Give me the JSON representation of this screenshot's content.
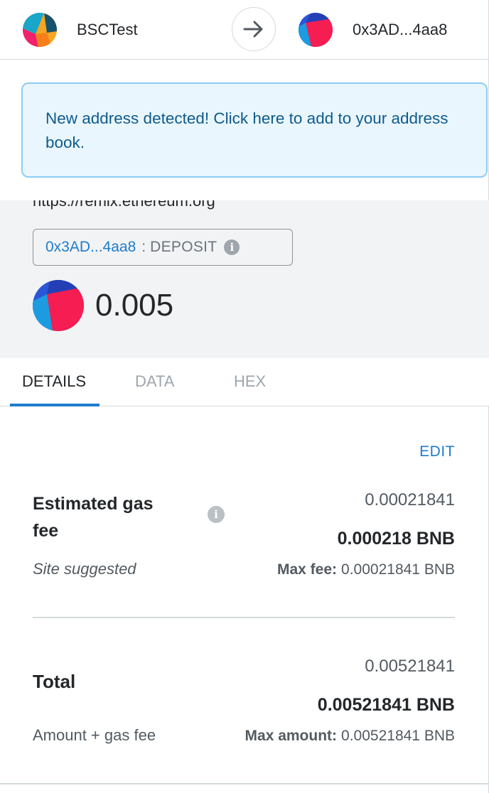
{
  "header": {
    "from_account": "BSCTest",
    "to_account": "0x3AD...4aa8"
  },
  "banner": {
    "text": "New address detected! Click here to add to your address book."
  },
  "summary": {
    "origin": "https://remix.ethereum.org",
    "method_address": "0x3AD...4aa8",
    "method_separator": ":",
    "method_name": "DEPOSIT",
    "amount": "0.005"
  },
  "tabs": [
    {
      "label": "DETAILS",
      "active": true
    },
    {
      "label": "DATA",
      "active": false
    },
    {
      "label": "HEX",
      "active": false
    }
  ],
  "details": {
    "edit_label": "EDIT",
    "gas": {
      "label": "Estimated gas fee",
      "sublabel": "Site suggested",
      "value": "0.00021841",
      "value_bold": "0.000218 BNB",
      "max_label": "Max fee:",
      "max_value": "0.00021841 BNB"
    },
    "total": {
      "label": "Total",
      "sublabel": "Amount + gas fee",
      "value": "0.00521841",
      "value_bold": "0.00521841 BNB",
      "max_label": "Max amount:",
      "max_value": "0.00521841 BNB"
    }
  },
  "icons": {
    "from_avatar": "jazzicon",
    "to_avatar": "jazzicon",
    "arrow": "arrow-right-icon",
    "info": "info-icon"
  },
  "colors": {
    "accent": "#1d7ccc",
    "banner_bg": "#eaf6fd",
    "banner_border": "#8ccdf4"
  }
}
